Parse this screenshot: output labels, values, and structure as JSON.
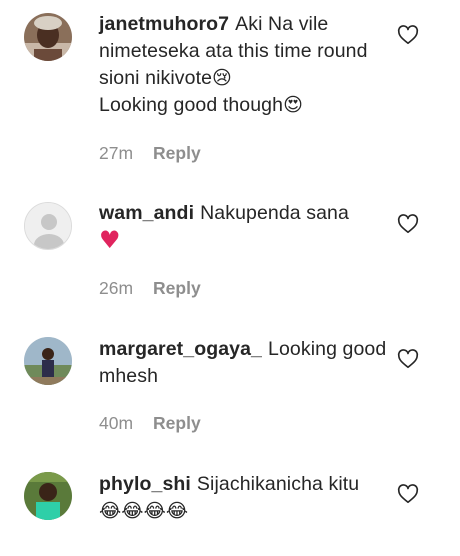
{
  "comments": [
    {
      "username": "janetmuhoro7",
      "text": "Aki Na vile nimeteseka ata this time round sioni nikivote",
      "emoji_1": "😢",
      "text_2": " Looking good though",
      "emoji_2": "😍",
      "time": "27m",
      "reply_label": "Reply",
      "avatar": "avatar-photo-person"
    },
    {
      "username": "wam_andi",
      "text": "Nakupenda sana",
      "emoji_1": "♥",
      "time": "26m",
      "reply_label": "Reply",
      "avatar": "default-avatar"
    },
    {
      "username": "margaret_ogaya_",
      "text": "Looking good mhesh",
      "time": "40m",
      "reply_label": "Reply",
      "avatar": "avatar-photo-outdoor"
    },
    {
      "username": "phylo_shi",
      "text": "Sijachikanicha kitu",
      "emoji_1": "😂😂😂😂",
      "avatar": "avatar-photo-green"
    }
  ],
  "colors": {
    "text": "#262626",
    "muted": "#8e8e8e",
    "heart": "#e0245e"
  },
  "icons": {
    "like": "heart-outline-icon"
  }
}
